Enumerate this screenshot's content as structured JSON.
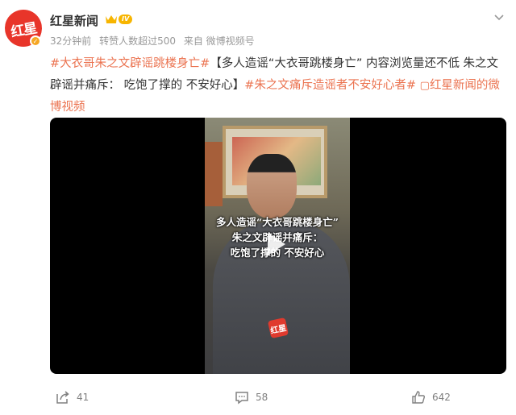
{
  "header": {
    "avatar_text": "红星",
    "username": "红星新闻",
    "level": "IV",
    "meta": {
      "time": "32分钟前",
      "reposts": "转赞人数超过500",
      "source": "来自 微博视频号"
    }
  },
  "content": {
    "tag1": "#大衣哥朱之文辟谣跳楼身亡#",
    "text1": "【多人造谣“大衣哥跳楼身亡” 内容浏览量还不低 朱之文辟谣并痛斥： 吃饱了撑的 不安好心】",
    "tag2": "#朱之文痛斥造谣者不安好心者#",
    "link_icon": "▢",
    "link_text": "红星新闻的微博视频"
  },
  "video": {
    "caption_line1": "多人造谣“大衣哥跳楼身亡”",
    "caption_line2": "朱之文辟谣并痛斥：",
    "caption_line3": "吃饱了撑的 不安好心",
    "watermark": "红星"
  },
  "footer": {
    "shares": "41",
    "comments": "58",
    "likes": "642"
  },
  "colors": {
    "accent": "#eb7350",
    "brand_red": "#e8352a"
  }
}
